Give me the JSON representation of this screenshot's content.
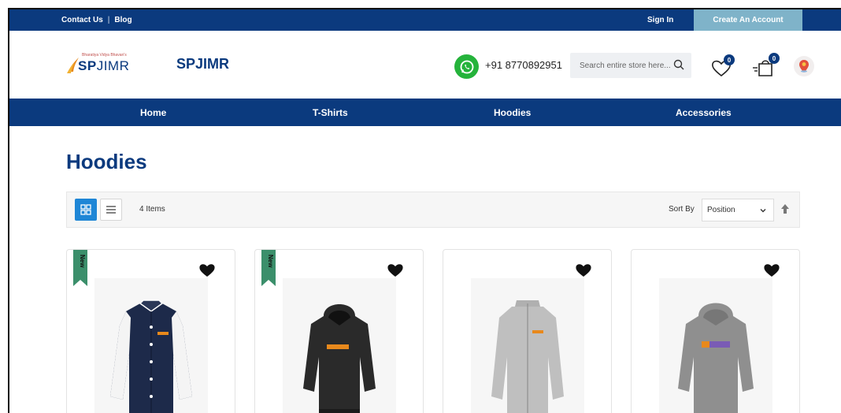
{
  "topbar": {
    "contact": "Contact Us",
    "separator": "|",
    "blog": "Blog",
    "signin": "Sign In",
    "create_account": "Create An Account"
  },
  "header": {
    "logo_tagline": "Bharatiya Vidya Bhavan's",
    "logo_sp": "SP",
    "logo_jimr": "JIMR",
    "brand": "SPJIMR",
    "phone": "+91 8770892951",
    "search_placeholder": "Search entire store here...",
    "wishlist_count": "0",
    "cart_count": "0"
  },
  "nav": {
    "items": [
      "Home",
      "T-Shirts",
      "Hoodies",
      "Accessories"
    ]
  },
  "page": {
    "title": "Hoodies"
  },
  "toolbar": {
    "count": "4 Items",
    "sort_label": "Sort By",
    "sort_value": "Position"
  },
  "products": [
    {
      "ribbon": "New",
      "kind": "varsity-jacket"
    },
    {
      "ribbon": "New",
      "kind": "black-hoodie"
    },
    {
      "ribbon": "",
      "kind": "grey-zip-jacket"
    },
    {
      "ribbon": "",
      "kind": "grey-hoodie"
    }
  ],
  "colors": {
    "brand_blue": "#0b3a7e",
    "create_account_bg": "#7fb3c9",
    "whatsapp_green": "#25b33b",
    "grid_button_blue": "#1f86d6",
    "ribbon_green": "#3b8f6b"
  }
}
